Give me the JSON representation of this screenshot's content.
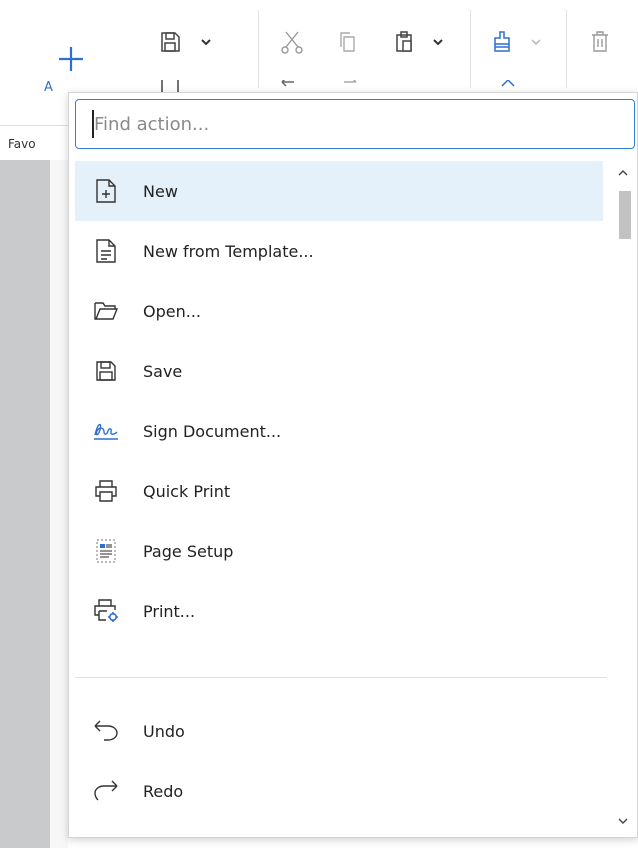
{
  "ribbon": {
    "add_label": "A",
    "favorites_label": "Favo",
    "icons": [
      "plus-icon",
      "save-icon",
      "chevron-down-icon",
      "cut-icon",
      "copy-icon",
      "paste-icon",
      "chevron-down-icon",
      "format-brush-icon",
      "chevron-down-icon",
      "delete-icon",
      "undo-icon",
      "redo-icon",
      "chevron-up-icon"
    ]
  },
  "search": {
    "placeholder": "Find action...",
    "value": ""
  },
  "actions": [
    {
      "label": "New",
      "icon": "new-document-icon",
      "selected": true
    },
    {
      "label": "New from Template...",
      "icon": "template-document-icon",
      "selected": false
    },
    {
      "label": "Open...",
      "icon": "folder-icon",
      "selected": false
    },
    {
      "label": "Save",
      "icon": "save-icon",
      "selected": false
    },
    {
      "label": "Sign Document...",
      "icon": "signature-icon",
      "selected": false
    },
    {
      "label": "Quick Print",
      "icon": "printer-icon",
      "selected": false
    },
    {
      "label": "Page Setup",
      "icon": "page-setup-icon",
      "selected": false
    },
    {
      "label": "Print...",
      "icon": "printer-settings-icon",
      "selected": false
    },
    {
      "label": "Undo",
      "icon": "undo-icon",
      "selected": false
    },
    {
      "label": "Redo",
      "icon": "redo-icon",
      "selected": false
    }
  ],
  "colors": {
    "accent": "#2f7fd6",
    "selected_bg": "#e4f1fb",
    "sign_icon": "#2f6fd1"
  }
}
